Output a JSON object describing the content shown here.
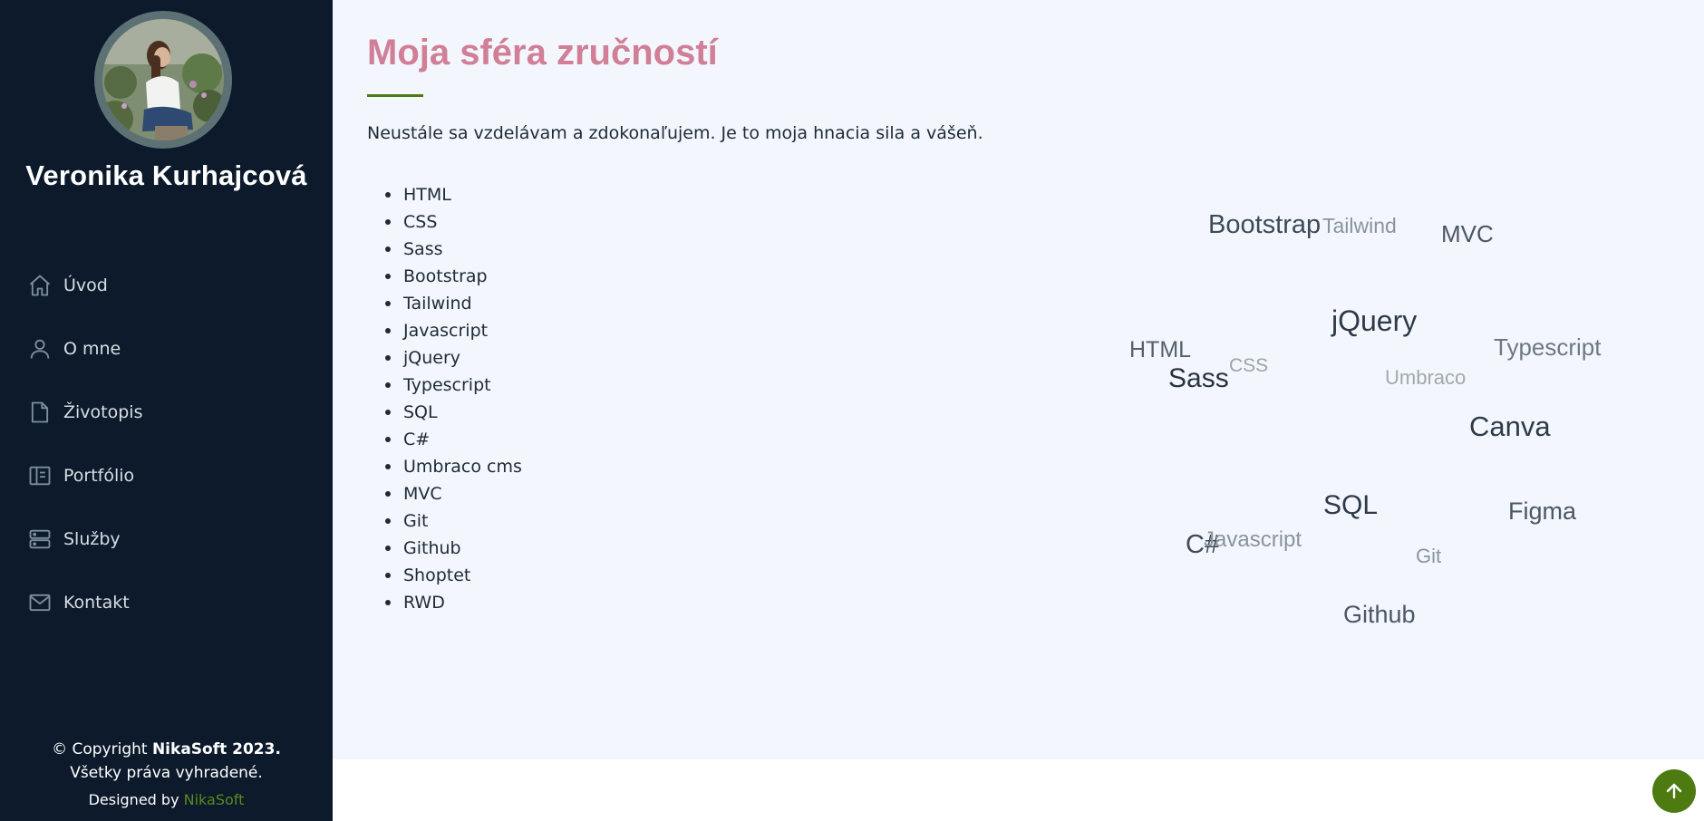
{
  "profile": {
    "name": "Veronika Kurhajcová"
  },
  "nav": [
    {
      "label": "Úvod",
      "icon": "home-icon"
    },
    {
      "label": "O mne",
      "icon": "user-icon"
    },
    {
      "label": "Životopis",
      "icon": "file-icon"
    },
    {
      "label": "Portfólio",
      "icon": "portfolio-icon"
    },
    {
      "label": "Služby",
      "icon": "server-icon"
    },
    {
      "label": "Kontakt",
      "icon": "envelope-icon"
    }
  ],
  "footer": {
    "copyright_prefix": "© Copyright ",
    "copyright_brand": "NikaSoft 2023.",
    "rights": "Všetky práva vyhradené.",
    "designed_by": "Designed by ",
    "designer": "NikaSoft"
  },
  "main": {
    "title": "Moja sféra zručností",
    "intro": "Neustále sa vzdelávam a zdokonaľujem. Je to moja hnacia sila a vášeň.",
    "skills": [
      "HTML",
      "CSS",
      "Sass",
      "Bootstrap",
      "Tailwind",
      "Javascript",
      "jQuery",
      "Typescript",
      "SQL",
      "C#",
      "Umbraco cms",
      "MVC",
      "Git",
      "Github",
      "Shoptet",
      "RWD"
    ]
  },
  "cloud": [
    {
      "text": "Bootstrap"
    },
    {
      "text": "Tailwind"
    },
    {
      "text": "MVC"
    },
    {
      "text": "jQuery"
    },
    {
      "text": "HTML"
    },
    {
      "text": "CSS"
    },
    {
      "text": "Sass"
    },
    {
      "text": "Typescript"
    },
    {
      "text": "Umbraco"
    },
    {
      "text": "Canva"
    },
    {
      "text": "SQL"
    },
    {
      "text": "Figma"
    },
    {
      "text": "C#"
    },
    {
      "text": "Javascript"
    },
    {
      "text": "Git"
    },
    {
      "text": "Github"
    }
  ],
  "colors": {
    "sidebar": "#0c1a2b",
    "title": "#d07f97",
    "accent": "#4e7a12",
    "content_bg": "#f3f7fd"
  },
  "scroll_top_icon": "arrow-up-icon"
}
